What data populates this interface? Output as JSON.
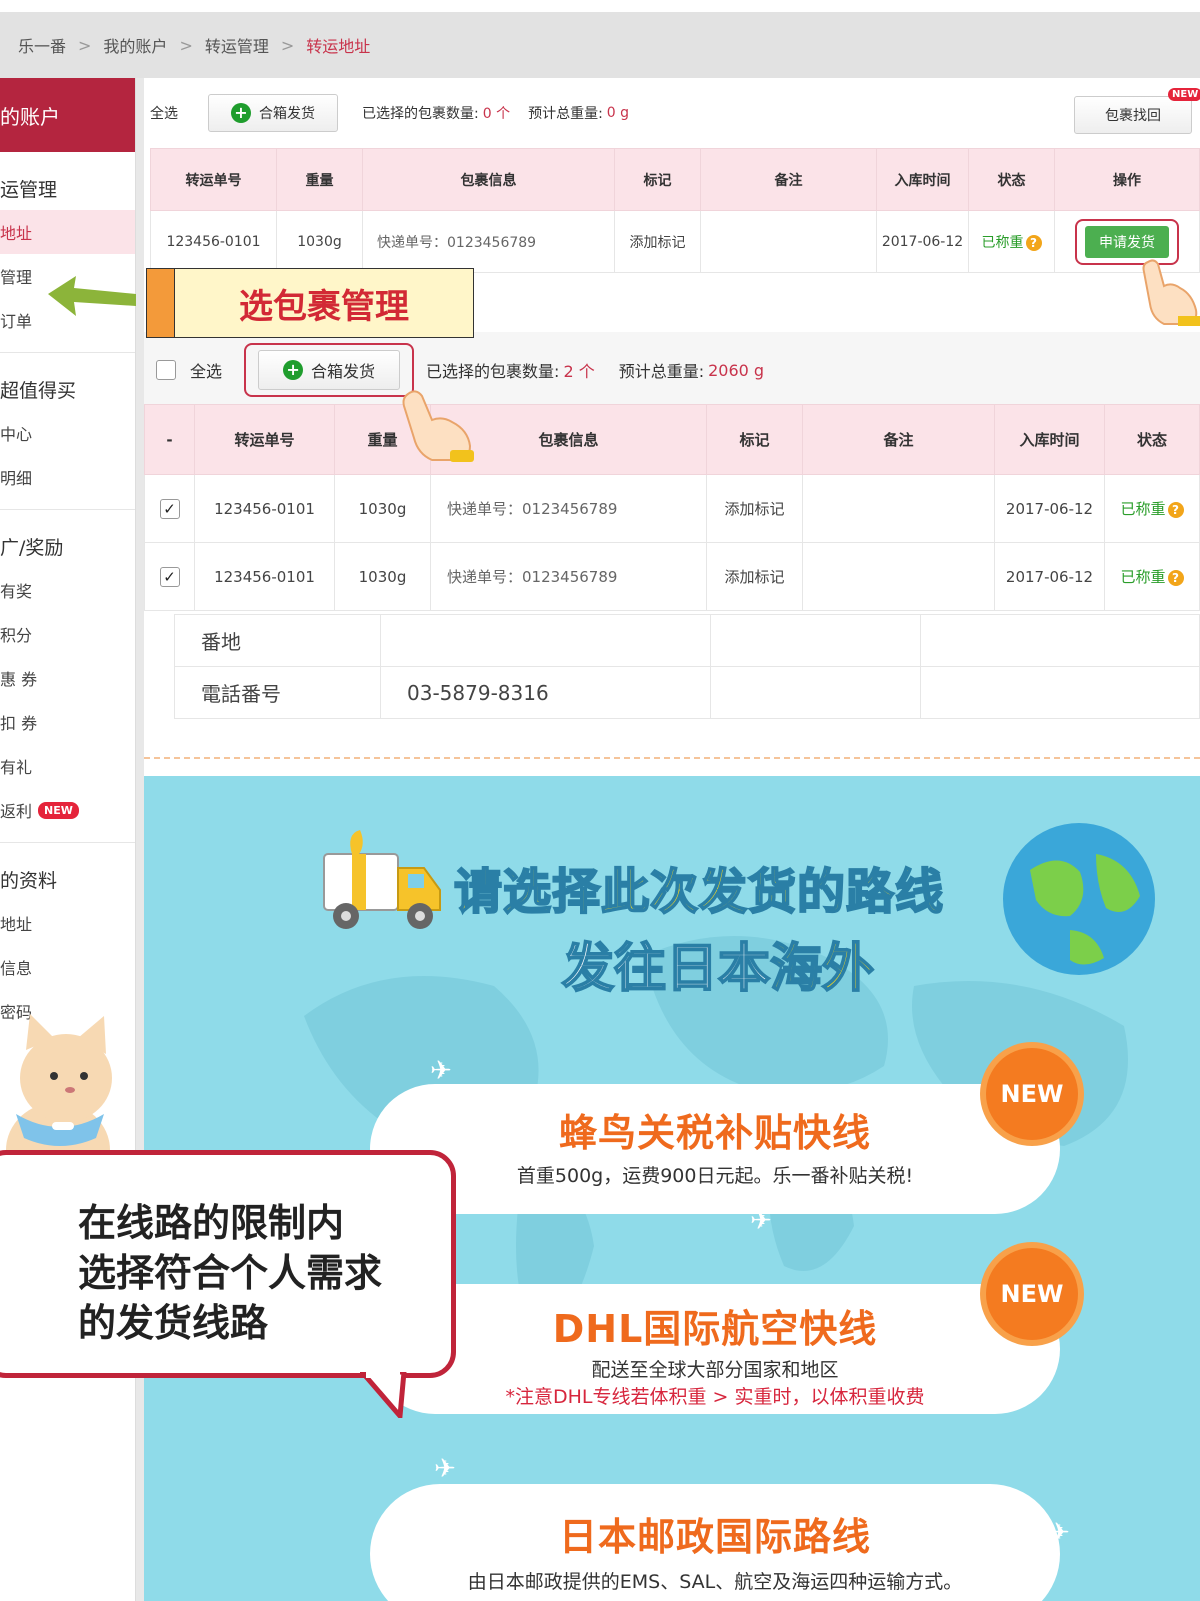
{
  "breadcrumb": {
    "items": [
      "乐一番",
      "我的账户",
      "转运管理"
    ],
    "current": "转运地址",
    "separator": ">"
  },
  "sidebar": {
    "header": "的账户",
    "sections": [
      {
        "title": "运管理",
        "items": [
          "地址",
          "管理",
          "订单"
        ]
      },
      {
        "title": "超值得买",
        "items": [
          "中心",
          "明细"
        ]
      },
      {
        "title": "广/奖励",
        "items": [
          "有奖",
          "积分",
          "惠 券",
          "扣 券",
          "有礼",
          "返利"
        ]
      },
      {
        "title": "的资料",
        "items": [
          "地址",
          "信息",
          "密码"
        ]
      }
    ],
    "new_badge": "NEW"
  },
  "toolbar1": {
    "select_all": "全选",
    "merge_btn": "合箱发货",
    "selected_label": "已选择的包裹数量:",
    "selected_count": "0 个",
    "weight_label": "预计总重量:",
    "weight_value": "0 g",
    "retrieve_btn": "包裹找回",
    "new_badge": "NEW"
  },
  "table1": {
    "headers": [
      "转运单号",
      "重量",
      "包裹信息",
      "标记",
      "备注",
      "入库时间",
      "状态",
      "操作"
    ],
    "row": {
      "id": "123456-0101",
      "weight": "1030g",
      "info": "快递单号：0123456789",
      "mark": "添加标记",
      "note": "",
      "date": "2017-06-12",
      "status": "已称重",
      "action": "申请发货"
    }
  },
  "annotation": "选包裹管理",
  "toolbar2": {
    "select_all": "全选",
    "merge_btn": "合箱发货",
    "selected_label": "已选择的包裹数量:",
    "selected_count": "2 个",
    "weight_label": "预计总重量:",
    "weight_value": "2060 g"
  },
  "table2": {
    "headers": [
      "-",
      "转运单号",
      "重量",
      "包裹信息",
      "标记",
      "备注",
      "入库时间",
      "状态"
    ],
    "rows": [
      {
        "id": "123456-0101",
        "weight": "1030g",
        "info": "快递单号：0123456789",
        "mark": "添加标记",
        "note": "",
        "date": "2017-06-12",
        "status": "已称重"
      },
      {
        "id": "123456-0101",
        "weight": "1030g",
        "info": "快递单号：0123456789",
        "mark": "添加标记",
        "note": "",
        "date": "2017-06-12",
        "status": "已称重"
      }
    ]
  },
  "address_table": {
    "rows": [
      {
        "label": "番地",
        "value": ""
      },
      {
        "label": "電話番号",
        "value": "03-5879-8316"
      }
    ]
  },
  "banner": {
    "title": "请选择此次发货的路线",
    "subtitle_a": "发往日本",
    "subtitle_b": "海外",
    "routes": [
      {
        "title": "蜂鸟关税补贴快线",
        "desc": "首重500g，运费900日元起。乐一番补贴关税!",
        "warn": "",
        "badge": "NEW"
      },
      {
        "title": "DHL国际航空快线",
        "desc": "配送至全球大部分国家和地区",
        "warn": "*注意DHL专线若体积重 > 实重时，以体积重收费",
        "badge": "NEW"
      },
      {
        "title": "日本邮政国际路线",
        "desc": "由日本邮政提供的EMS、SAL、航空及海运四种运输方式。",
        "warn": "",
        "badge": ""
      }
    ]
  },
  "speech": {
    "lines": [
      "在线路的限制内",
      "选择符合个人需求",
      "的发货线路"
    ]
  },
  "colors": {
    "brand": "#b4253f",
    "accent": "#c8334b",
    "green": "#3aa93a",
    "banner_bg": "#8fdbe9",
    "route_title": "#ef6a1d"
  }
}
